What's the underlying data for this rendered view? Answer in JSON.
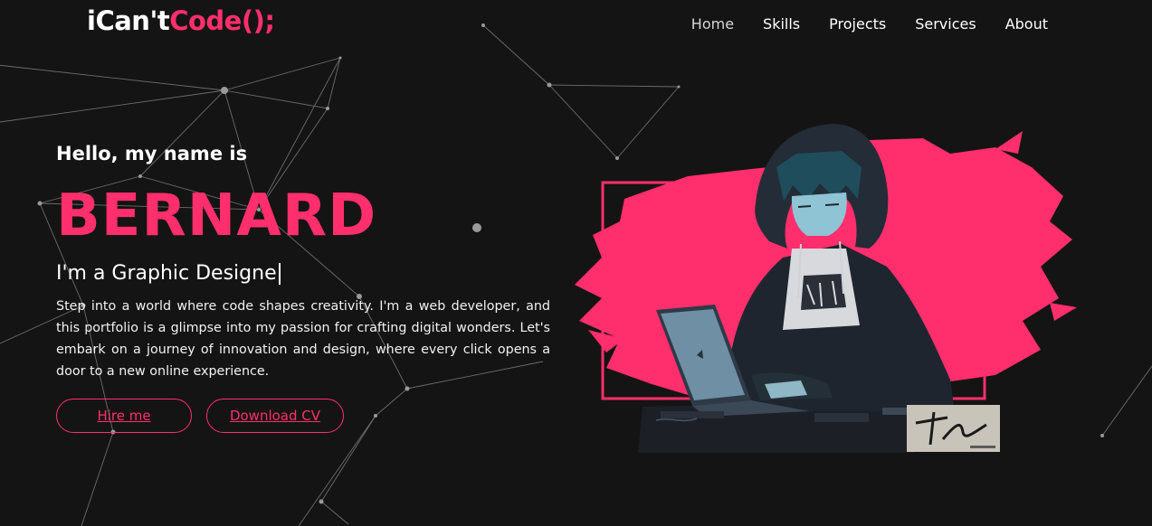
{
  "brand": {
    "logo_main": "iCan't",
    "logo_accent": "Code();"
  },
  "nav": {
    "items": [
      "Home",
      "Skills",
      "Projects",
      "Services",
      "About"
    ]
  },
  "hero": {
    "greeting": "Hello, my name is",
    "name": "BERNARD",
    "role": "I'm a Graphic Designe",
    "bio": "Step into a world where code shapes creativity. I'm a web developer, and this portfolio is a glimpse into my passion for crafting digital wonders. Let's embark on a journey of innovation and design, where every click opens a door to a new online experience.",
    "hire_label": "Hire me",
    "cv_label": "Download CV"
  },
  "colors": {
    "accent": "#ff2e6c",
    "background": "#141414"
  },
  "icons": {
    "illustration": "hooded-coder-illustration",
    "signature": "artist-signature"
  }
}
